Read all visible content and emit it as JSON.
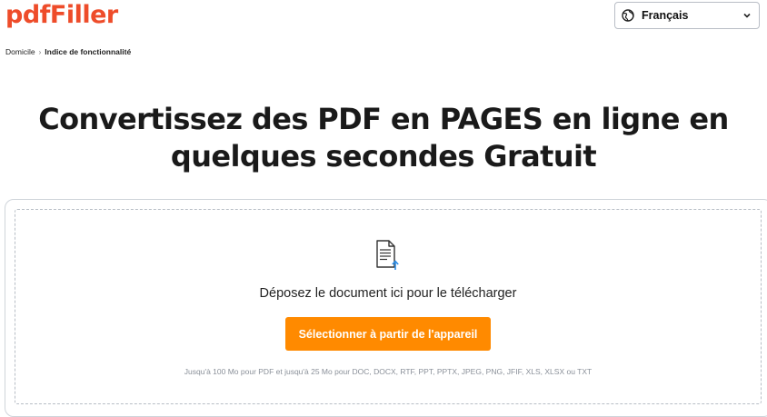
{
  "header": {
    "logo_text": "pdfFiller",
    "language": {
      "selected": "Français",
      "icons": {
        "globe": "globe-icon",
        "chevron": "chevron-down-icon"
      }
    }
  },
  "breadcrumb": {
    "items": [
      "Domicile",
      "Indice de fonctionnalité"
    ],
    "separator": "›"
  },
  "main": {
    "title_line1": "Convertissez des PDF en PAGES en ligne en",
    "title_line2": "quelques secondes Gratuit"
  },
  "upload": {
    "icon": "document-upload-icon",
    "drop_text": "Déposez le document ici pour le télécharger",
    "button_label": "Sélectionner à partir de l'appareil",
    "limits_text": "Jusqu'à 100 Mo pour PDF et jusqu'à 25 Mo pour DOC, DOCX, RTF, PPT, PPTX, JPEG, PNG, JFIF, XLS, XLSX ou TXT"
  },
  "colors": {
    "brand": "#ee4c2a",
    "button": "#ff8a00",
    "upload_arrow": "#2b8ce6"
  }
}
